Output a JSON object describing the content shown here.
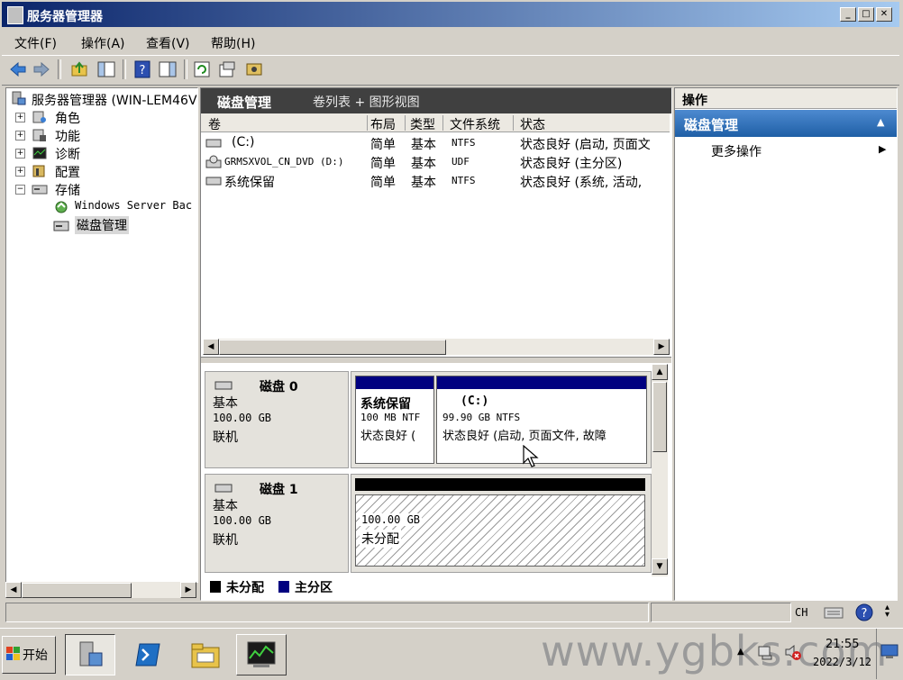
{
  "window": {
    "title": "服务器管理器"
  },
  "menu": {
    "items": [
      "文件(F)",
      "操作(A)",
      "查看(V)",
      "帮助(H)"
    ]
  },
  "tree": {
    "root": "服务器管理器 (WIN-LEM46V",
    "items": [
      {
        "label": "角色",
        "expander": "+"
      },
      {
        "label": "功能",
        "expander": "+"
      },
      {
        "label": "诊断",
        "expander": "+"
      },
      {
        "label": "配置",
        "expander": "+"
      },
      {
        "label": "存储",
        "expander": "−"
      }
    ],
    "children": [
      "Windows Server Bac",
      "磁盘管理"
    ]
  },
  "center": {
    "title": "磁盘管理",
    "subtitle": "卷列表 + 图形视图",
    "columns": [
      "卷",
      "布局",
      "类型",
      "文件系统",
      "状态"
    ],
    "rows": [
      {
        "vol": "(C:)",
        "layout": "简单",
        "type": "基本",
        "fs": "NTFS",
        "status": "状态良好 (启动, 页面文"
      },
      {
        "vol": "GRMSXVOL_CN_DVD (D:)",
        "layout": "简单",
        "type": "基本",
        "fs": "UDF",
        "status": "状态良好 (主分区)"
      },
      {
        "vol": "系统保留",
        "layout": "简单",
        "type": "基本",
        "fs": "NTFS",
        "status": "状态良好 (系统, 活动,"
      }
    ]
  },
  "disks": [
    {
      "name": "磁盘 0",
      "kind": "基本",
      "size": "100.00 GB",
      "state": "联机",
      "volumes": [
        {
          "name": "系统保留",
          "size": "100 MB NTF",
          "status": "状态良好 ("
        },
        {
          "name": "(C:)",
          "size": "99.90 GB NTFS",
          "status": "状态良好 (启动, 页面文件, 故障"
        }
      ]
    },
    {
      "name": "磁盘 1",
      "kind": "基本",
      "size": "100.00 GB",
      "state": "联机",
      "volumes": [
        {
          "size": "100.00 GB",
          "status": "未分配"
        }
      ]
    }
  ],
  "legend": {
    "unallocated": "未分配",
    "primary": "主分区"
  },
  "colors": {
    "primary": "#000080",
    "unallocated": "#000000",
    "header_dark": "#404040",
    "action_blue": "#1f5fa6"
  },
  "actions": {
    "header": "操作",
    "section": "磁盘管理",
    "more": "更多操作"
  },
  "statusbar": {
    "ime": "CH"
  },
  "taskbar": {
    "start": "开始",
    "time": "21:55",
    "date": "2022/3/12"
  },
  "watermark": "www.ygbks.com"
}
